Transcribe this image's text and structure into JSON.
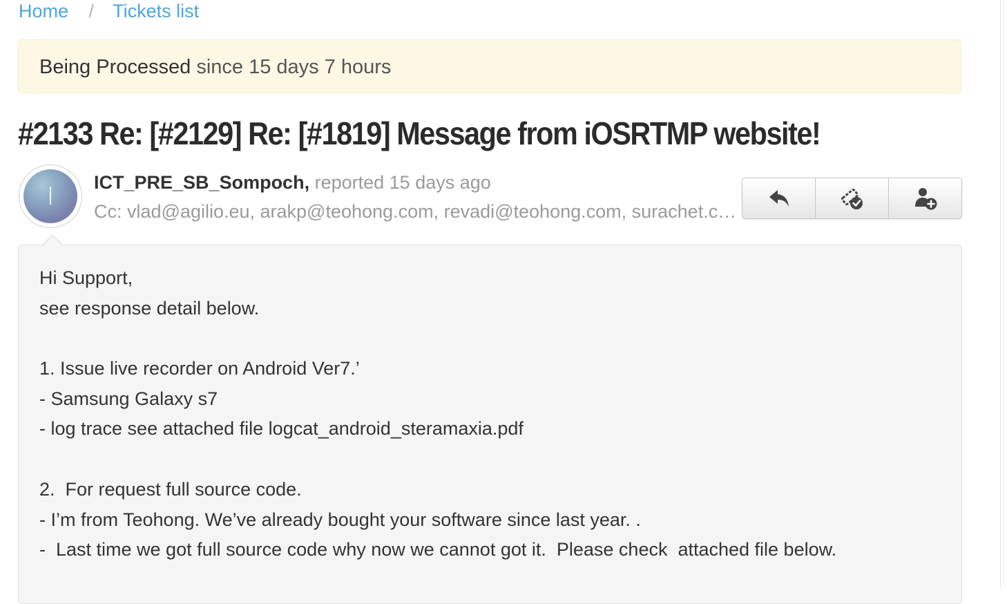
{
  "breadcrumb": {
    "home": "Home",
    "separator": "/",
    "current": "Tickets list"
  },
  "status": {
    "state": "Being Processed",
    "since": "since 15 days 7 hours"
  },
  "ticket": {
    "title": "#2133 Re: [#2129] Re: [#1819] Message from iOSRTMP website!"
  },
  "reporter": {
    "name": "ICT_PRE_SB_Sompoch,",
    "reported": "reported 15 days ago",
    "cc": "Cc: vlad@agilio.eu, arakp@teohong.com, revadi@teohong.com, surachet.c@teohong.com"
  },
  "actions": [
    {
      "icon": "reply-icon"
    },
    {
      "icon": "close-ticket-icon"
    },
    {
      "icon": "add-user-icon"
    }
  ],
  "message": {
    "lines": [
      "Hi Support,",
      "see response detail below.",
      "",
      "1. Issue live recorder on Android Ver7.’",
      "- Samsung Galaxy s7",
      "- log trace see attached file logcat_android_steramaxia.pdf",
      "",
      "2.  For request full source code.",
      "- I’m from Teohong. We’ve already bought your software since last year. .",
      "-  Last time we got full source code why now we cannot got it.  Please check  attached file below."
    ]
  },
  "colors": {
    "link": "#4ba6dd",
    "banner_bg": "#fcf8e3",
    "banner_border": "#faebcc",
    "muted_text": "#9a9a9a",
    "message_bg": "#f5f5f5"
  }
}
